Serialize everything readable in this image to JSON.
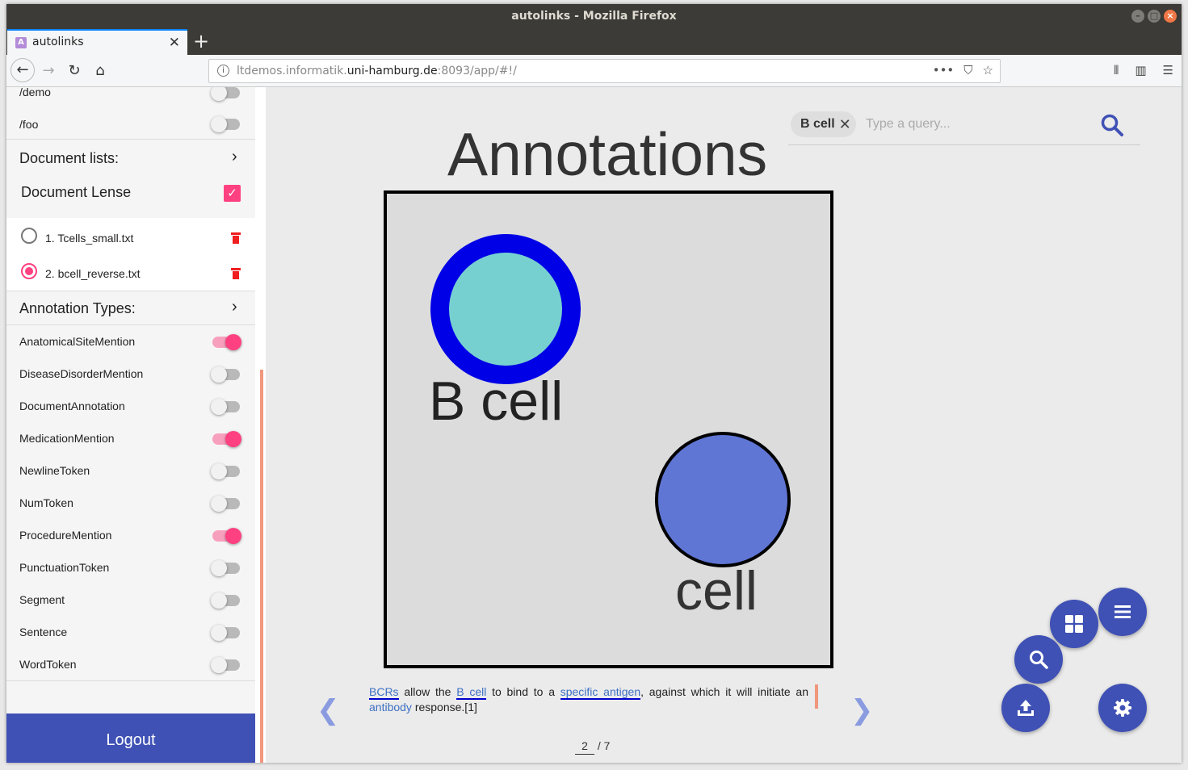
{
  "window": {
    "title": "autolinks - Mozilla Firefox"
  },
  "browser": {
    "tab_title": "autolinks",
    "url_prefix": "ltdemos.informatik.",
    "url_host": "uni-hamburg.de",
    "url_suffix": ":8093/app/#!/"
  },
  "sidebar": {
    "top_items": [
      {
        "label": "/demo",
        "on": false
      },
      {
        "label": "/foo",
        "on": false
      }
    ],
    "doc_lists_header": "Document lists:",
    "doc_lense_label": "Document Lense",
    "documents": [
      {
        "label": "1. Tcells_small.txt",
        "selected": false
      },
      {
        "label": "2. bcell_reverse.txt",
        "selected": true
      }
    ],
    "anno_types_header": "Annotation Types:",
    "annotation_types": [
      {
        "label": "AnatomicalSiteMention",
        "on": true
      },
      {
        "label": "DiseaseDisorderMention",
        "on": false
      },
      {
        "label": "DocumentAnnotation",
        "on": false
      },
      {
        "label": "MedicationMention",
        "on": true
      },
      {
        "label": "NewlineToken",
        "on": false
      },
      {
        "label": "NumToken",
        "on": false
      },
      {
        "label": "ProcedureMention",
        "on": true
      },
      {
        "label": "PunctuationToken",
        "on": false
      },
      {
        "label": "Segment",
        "on": false
      },
      {
        "label": "Sentence",
        "on": false
      },
      {
        "label": "WordToken",
        "on": false
      }
    ],
    "logout_label": "Logout"
  },
  "search": {
    "chip_label": "B cell",
    "placeholder": "Type a query..."
  },
  "annotations": {
    "title": "Annotations",
    "node1_label": "B cell",
    "node2_label": "cell"
  },
  "document_text": {
    "t1": "BCRs",
    "t2": " allow the ",
    "t3": "B cell",
    "t4": " to bind to a ",
    "t5": "specific antigen",
    "t6": ", against which it will initiate an ",
    "t7": "antibody",
    "t8": " response.[1]"
  },
  "pager": {
    "current": "2",
    "total": "/ 7"
  },
  "colors": {
    "accent": "#ff4081",
    "primary": "#3f51b5"
  }
}
